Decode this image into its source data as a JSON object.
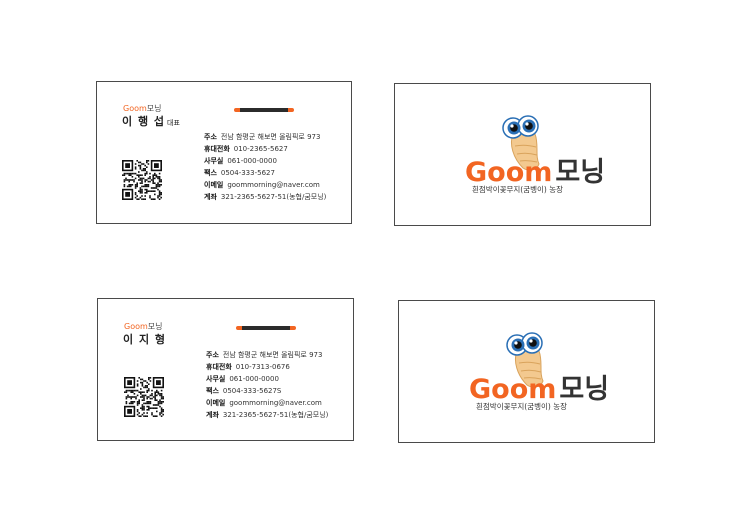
{
  "brand": {
    "goom": "Goom",
    "morning": "모닝"
  },
  "cards": [
    {
      "name": "이 행 섭",
      "title": "대표",
      "address_label": "주소",
      "address": "전남 함평군 해보면 올림픽로 973",
      "mobile_label": "휴대전화",
      "mobile": "010-2365-5627",
      "office_label": "사무실",
      "office": "061-000-0000",
      "fax_label": "팩스",
      "fax": "0504-333-5627",
      "email_label": "이메일",
      "email": "goommorning@naver.com",
      "account_label": "계좌",
      "account": "321-2365-5627-51(농협/굼모닝)"
    },
    {
      "name": "이 지 형",
      "title": "",
      "address_label": "주소",
      "address": "전남 함평군 해보면 올림픽로 973",
      "mobile_label": "휴대전화",
      "mobile": "010-7313-0676",
      "office_label": "사무실",
      "office": "061-000-0000",
      "fax_label": "팩스",
      "fax": "0504-333-5627S",
      "email_label": "이메일",
      "email": "goommorning@naver.com",
      "account_label": "계좌",
      "account": "321-2365-5627-51(농협/굼모닝)"
    }
  ],
  "back": {
    "logo_goom": "Goom",
    "logo_morning": "모닝",
    "tagline": "흰점박이꽃무지(굼벵이) 농장"
  },
  "colors": {
    "accent": "#f26522",
    "dark": "#2b2b2b"
  }
}
